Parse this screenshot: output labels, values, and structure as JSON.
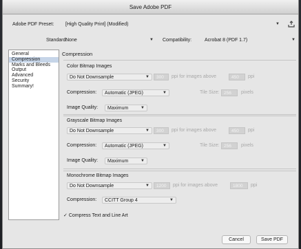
{
  "window": {
    "title": "Save Adobe PDF"
  },
  "preset": {
    "label": "Adobe PDF Preset:",
    "value": "[High Quality Print] (Modified)"
  },
  "standard": {
    "label": "Standard:",
    "value": "None"
  },
  "compatibility": {
    "label": "Compatibility:",
    "value": "Acrobat 8 (PDF 1.7)"
  },
  "sidebar": {
    "items": [
      "General",
      "Compression",
      "Marks and Bleeds",
      "Output",
      "Advanced",
      "Security",
      "Summary!"
    ],
    "selected_index": 1
  },
  "panel": {
    "title": "Compression"
  },
  "color": {
    "title": "Color Bitmap Images",
    "downsample": "Do Not Downsample",
    "ppi": "300",
    "ppi_label": "ppi for images above",
    "above": "450",
    "above_unit": "ppi",
    "compression_label": "Compression:",
    "compression": "Automatic (JPEG)",
    "tile_label": "Tile Size:",
    "tile": "256",
    "tile_unit": "pixels",
    "quality_label": "Image Quality:",
    "quality": "Maximum"
  },
  "grayscale": {
    "title": "Grayscale Bitmap Images",
    "downsample": "Do Not Downsample",
    "ppi": "300",
    "ppi_label": "ppi for images above",
    "above": "450",
    "above_unit": "ppi",
    "compression_label": "Compression:",
    "compression": "Automatic (JPEG)",
    "tile_label": "Tile Size:",
    "tile": "256",
    "tile_unit": "pixels",
    "quality_label": "Image Quality:",
    "quality": "Maximum"
  },
  "mono": {
    "title": "Monochrome Bitmap Images",
    "downsample": "Do Not Downsample",
    "ppi": "1200",
    "ppi_label": "ppi for images above",
    "above": "1800",
    "above_unit": "ppi",
    "compression_label": "Compression:",
    "compression": "CCITT Group 4"
  },
  "compress_text": {
    "mark": "✓",
    "label": "Compress Text and Line Art"
  },
  "buttons": {
    "cancel": "Cancel",
    "save": "Save PDF"
  }
}
